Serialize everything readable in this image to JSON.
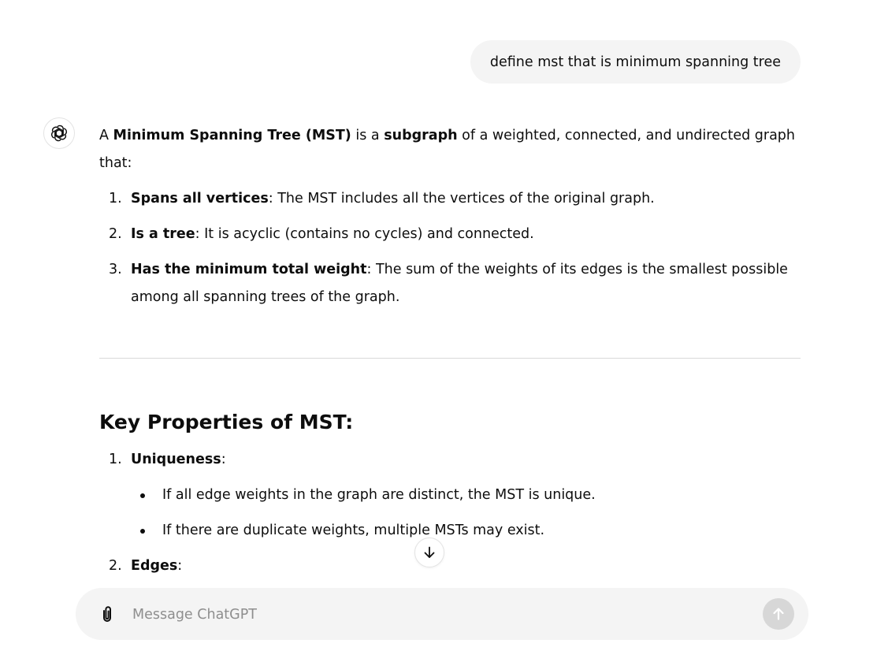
{
  "conversation": {
    "user_message": "define mst that is minimum spanning tree",
    "assistant": {
      "intro": {
        "t1": "A ",
        "b1": "Minimum Spanning Tree (MST)",
        "t2": " is a ",
        "b2": "subgraph",
        "t3": " of a weighted, connected, and undirected graph that:"
      },
      "points": [
        {
          "num": "1.",
          "bold": "Spans all vertices",
          "text": ": The MST includes all the vertices of the original graph."
        },
        {
          "num": "2.",
          "bold": "Is a tree",
          "text": ": It is acyclic (contains no cycles) and connected."
        },
        {
          "num": "3.",
          "bold": "Has the minimum total weight",
          "text": ": The sum of the weights of its edges is the smallest possible among all spanning trees of the graph."
        }
      ],
      "section": {
        "heading": "Key Properties of MST:",
        "items": [
          {
            "num": "1.",
            "bold": "Uniqueness",
            "text": ":",
            "bullets": [
              "If all edge weights in the graph are distinct, the MST is unique.",
              "If there are duplicate weights, multiple MSTs may exist."
            ]
          },
          {
            "num": "2.",
            "bold": "Edges",
            "text": ":"
          }
        ]
      }
    }
  },
  "composer": {
    "placeholder": "Message ChatGPT"
  },
  "icons": {
    "avatar": "openai-logo-icon",
    "scroll": "arrow-down-icon",
    "attach": "paperclip-icon",
    "send": "arrow-up-icon"
  },
  "colors": {
    "bubble": "#f4f4f4",
    "send_disabled": "#d7d7d7",
    "text": "#0d0d0d"
  }
}
